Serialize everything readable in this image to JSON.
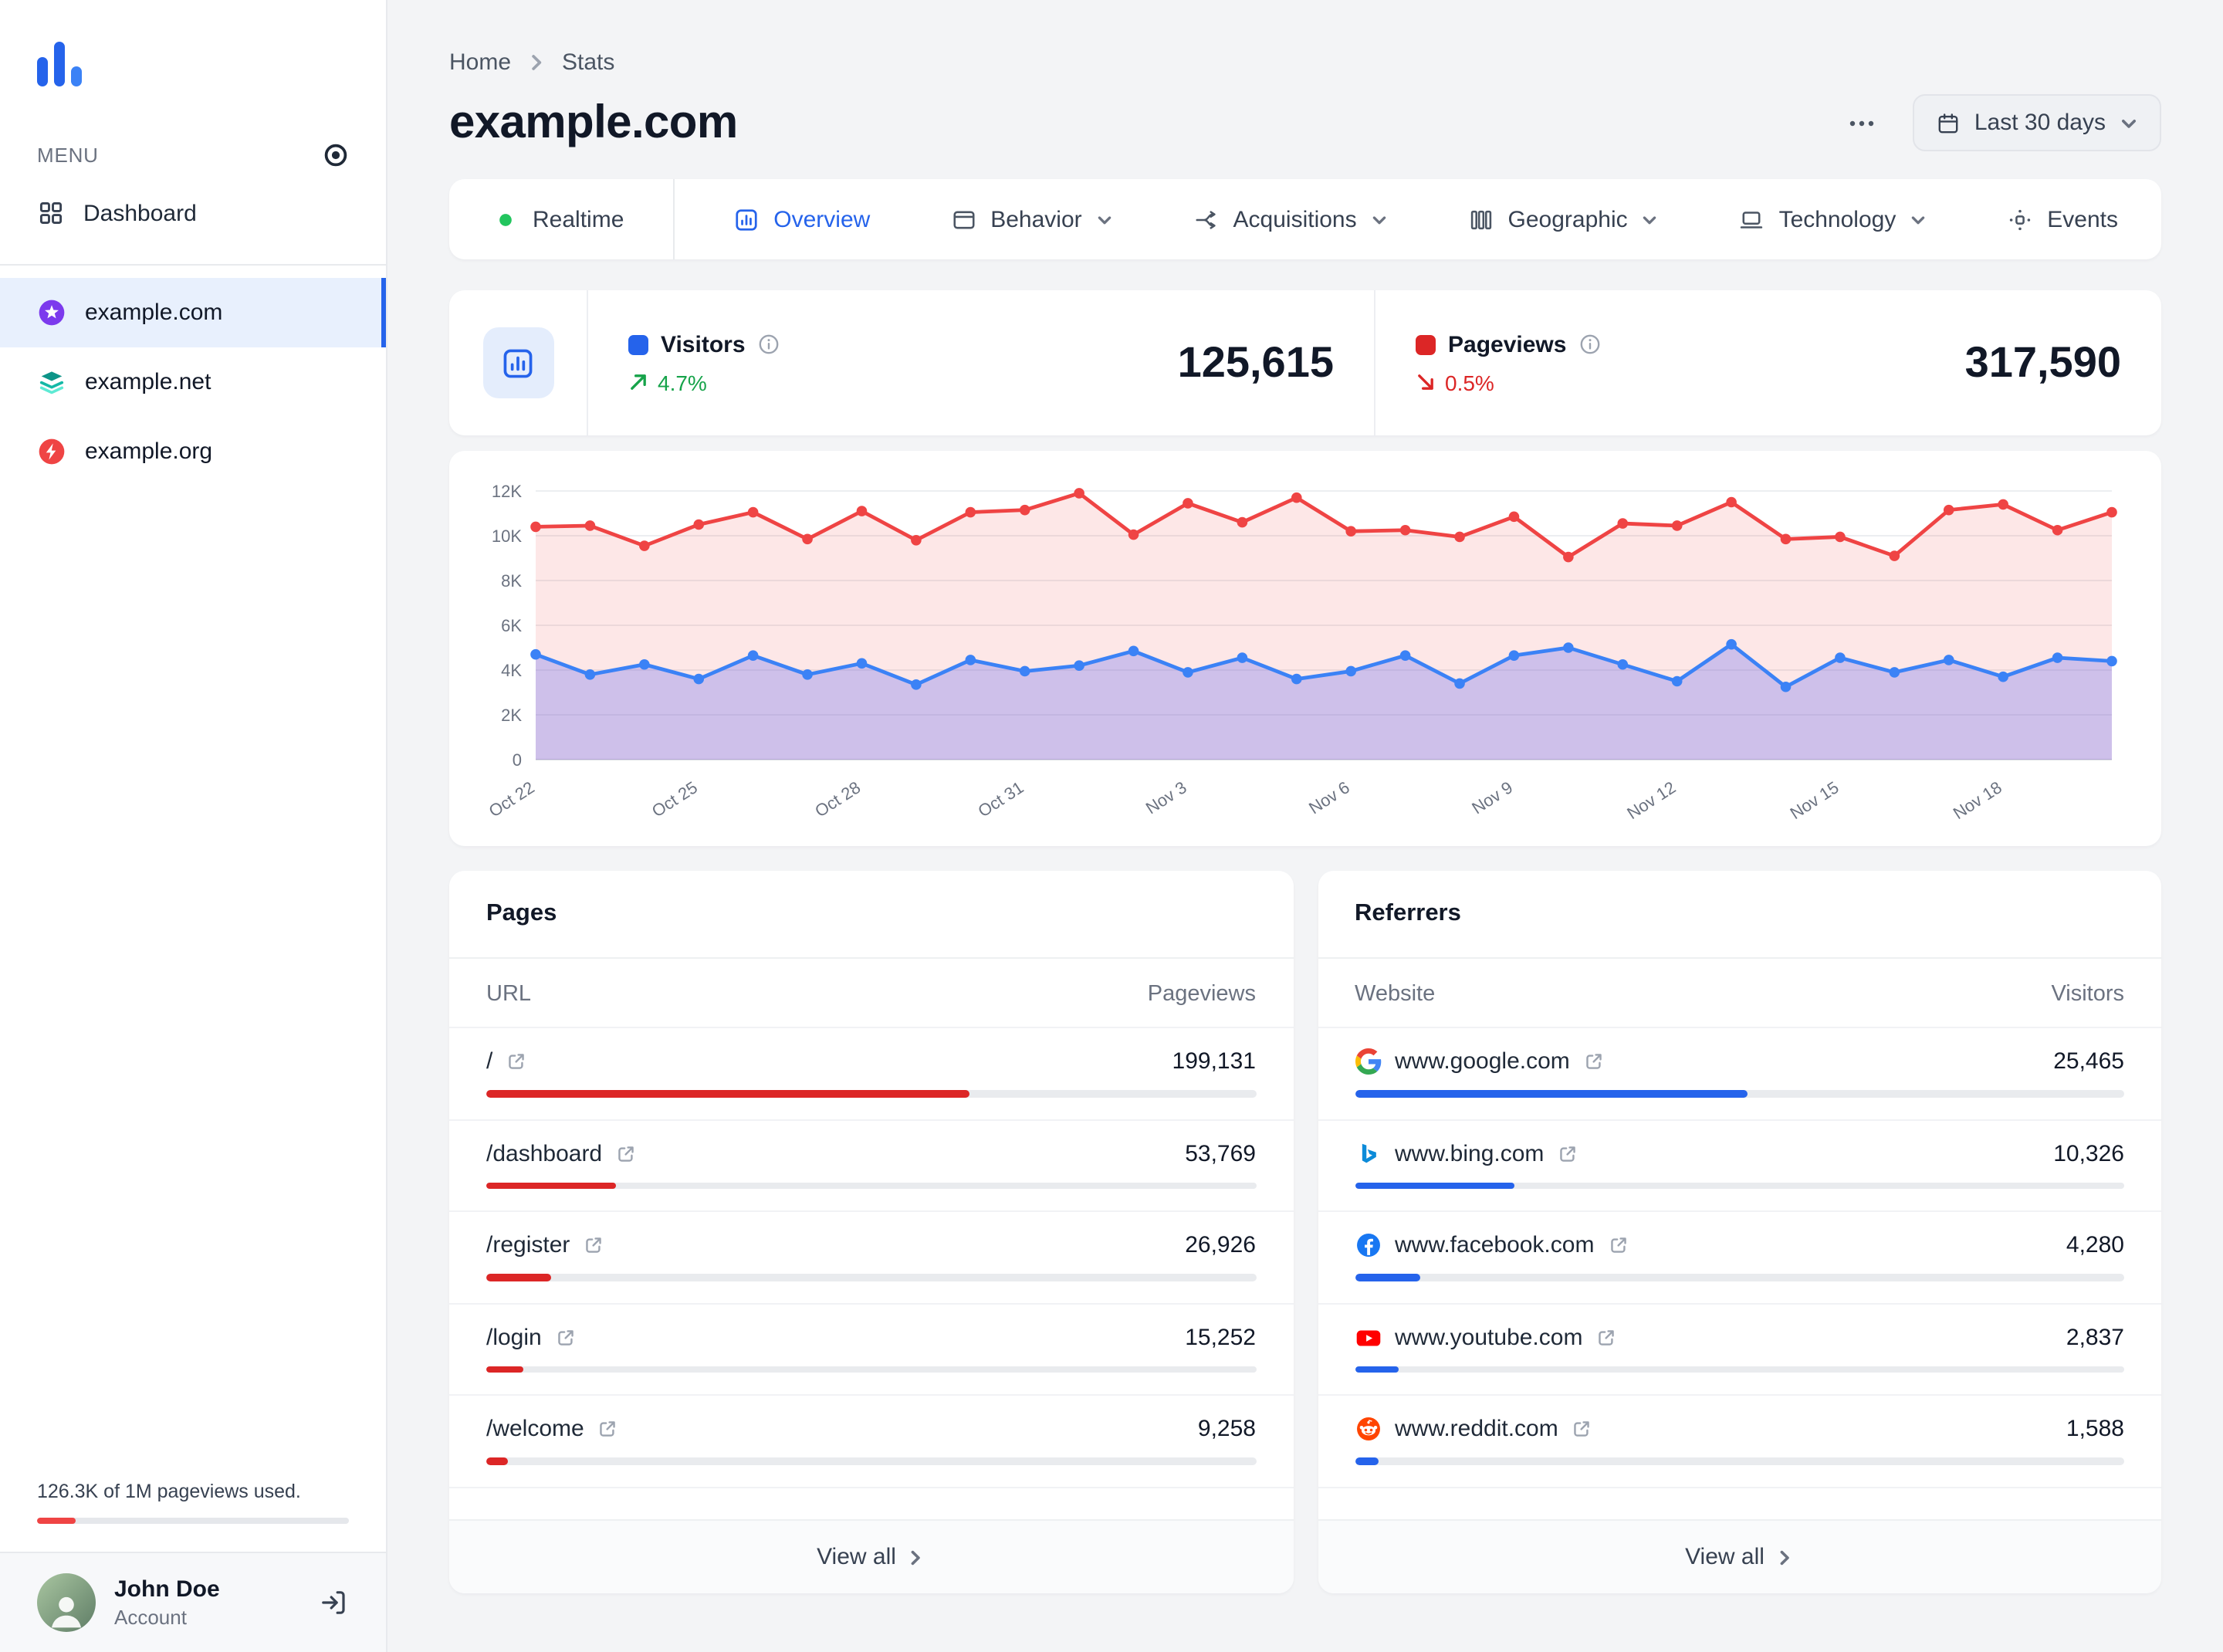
{
  "sidebar": {
    "menu_label": "MENU",
    "dashboard_label": "Dashboard",
    "sites": [
      {
        "name": "example.com",
        "icon": "site-com-favicon",
        "active": true
      },
      {
        "name": "example.net",
        "icon": "site-net-favicon",
        "active": false
      },
      {
        "name": "example.org",
        "icon": "site-org-favicon",
        "active": false
      }
    ],
    "usage": {
      "text": "126.3K of 1M pageviews used.",
      "pct": 12.6
    },
    "user": {
      "name": "John Doe",
      "role": "Account"
    }
  },
  "header": {
    "breadcrumb": {
      "home": "Home",
      "current": "Stats"
    },
    "title": "example.com",
    "date_range_label": "Last 30 days"
  },
  "tabs": [
    {
      "label": "Realtime",
      "icon": "realtime-dot-icon",
      "active": false,
      "chevron": false,
      "divider_after": true
    },
    {
      "label": "Overview",
      "icon": "overview-icon",
      "active": true,
      "chevron": false
    },
    {
      "label": "Behavior",
      "icon": "behavior-icon",
      "active": false,
      "chevron": true
    },
    {
      "label": "Acquisitions",
      "icon": "acquisitions-icon",
      "active": false,
      "chevron": true
    },
    {
      "label": "Geographic",
      "icon": "geographic-icon",
      "active": false,
      "chevron": true
    },
    {
      "label": "Technology",
      "icon": "technology-icon",
      "active": false,
      "chevron": true
    },
    {
      "label": "Events",
      "icon": "events-icon",
      "active": false,
      "chevron": false
    }
  ],
  "stats": {
    "visitors": {
      "label": "Visitors",
      "change": "4.7%",
      "trend": "up",
      "value": "125,615"
    },
    "pageviews": {
      "label": "Pageviews",
      "change": "0.5%",
      "trend": "down",
      "value": "317,590"
    }
  },
  "chart_data": {
    "type": "area",
    "x_tick_labels": [
      "Oct 22",
      "Oct 25",
      "Oct 28",
      "Oct 31",
      "Nov 3",
      "Nov 6",
      "Nov 9",
      "Nov 12",
      "Nov 15",
      "Nov 18"
    ],
    "x_tick_indices": [
      0,
      3,
      6,
      9,
      12,
      15,
      18,
      21,
      24,
      27
    ],
    "y_ticks": {
      "values": [
        0,
        2000,
        4000,
        6000,
        8000,
        10000,
        12000
      ],
      "labels": [
        "0",
        "2K",
        "4K",
        "6K",
        "8K",
        "10K",
        "12K"
      ]
    },
    "ylim": [
      0,
      12000
    ],
    "grid": true,
    "series": [
      {
        "name": "Pageviews",
        "color": "#ef4444",
        "fill": "rgba(239,68,68,0.13)",
        "values": [
          10400,
          10450,
          9550,
          10500,
          11050,
          9850,
          11100,
          9800,
          11050,
          11150,
          11900,
          10050,
          11450,
          10600,
          11700,
          10200,
          10250,
          9950,
          10850,
          9050,
          10550,
          10450,
          11500,
          9850,
          9950,
          9100,
          11150,
          11400,
          10250,
          11050
        ]
      },
      {
        "name": "Visitors",
        "color": "#3b82f6",
        "fill": "rgba(99,102,241,0.30)",
        "values": [
          4700,
          3800,
          4250,
          3600,
          4650,
          3800,
          4300,
          3350,
          4450,
          3950,
          4200,
          4850,
          3900,
          4550,
          3600,
          3950,
          4650,
          3400,
          4650,
          5000,
          4250,
          3500,
          5150,
          3250,
          4550,
          3900,
          4450,
          3700,
          4550,
          4400
        ]
      }
    ]
  },
  "pages": {
    "title": "Pages",
    "columns": {
      "name": "URL",
      "value": "Pageviews"
    },
    "rows": [
      {
        "label": "/",
        "value": "199,131",
        "pct": 62.7
      },
      {
        "label": "/dashboard",
        "value": "53,769",
        "pct": 16.9
      },
      {
        "label": "/register",
        "value": "26,926",
        "pct": 8.5
      },
      {
        "label": "/login",
        "value": "15,252",
        "pct": 4.8
      },
      {
        "label": "/welcome",
        "value": "9,258",
        "pct": 2.9
      }
    ],
    "view_all_label": "View all"
  },
  "referrers": {
    "title": "Referrers",
    "columns": {
      "name": "Website",
      "value": "Visitors"
    },
    "rows": [
      {
        "label": "www.google.com",
        "icon": "google-favicon",
        "value": "25,465",
        "pct": 51.0
      },
      {
        "label": "www.bing.com",
        "icon": "bing-favicon",
        "value": "10,326",
        "pct": 20.7
      },
      {
        "label": "www.facebook.com",
        "icon": "facebook-favicon",
        "value": "4,280",
        "pct": 8.6
      },
      {
        "label": "www.youtube.com",
        "icon": "youtube-favicon",
        "value": "2,837",
        "pct": 5.7
      },
      {
        "label": "www.reddit.com",
        "icon": "reddit-favicon",
        "value": "1,588",
        "pct": 3.2
      }
    ],
    "view_all_label": "View all"
  }
}
